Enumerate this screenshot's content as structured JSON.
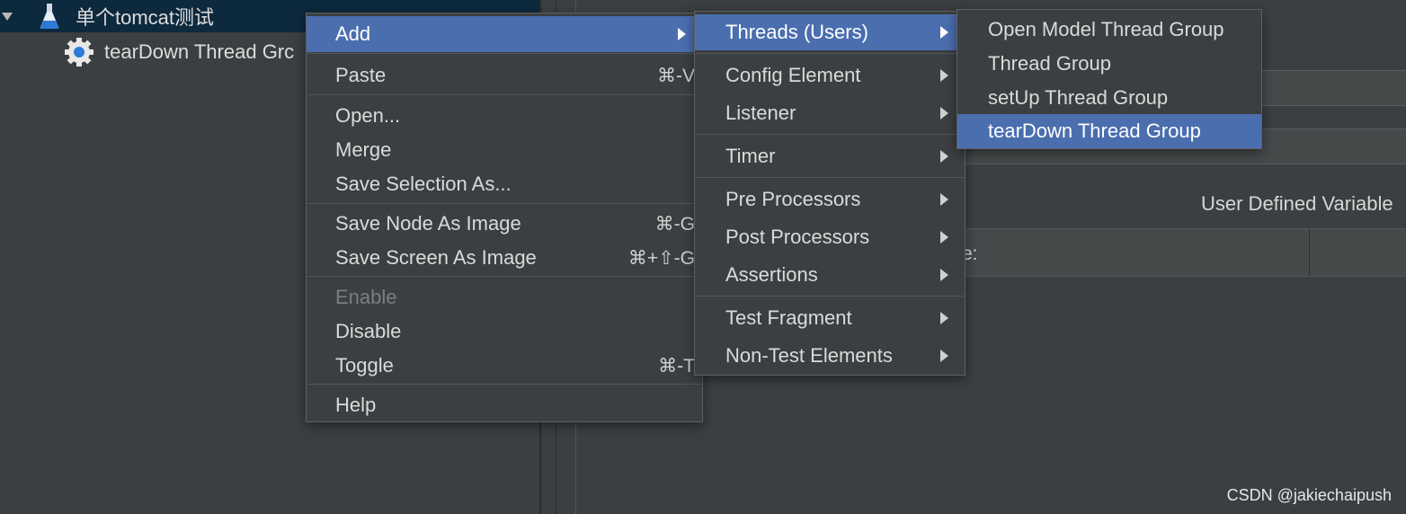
{
  "tree": {
    "root_label": "单个tomcat测试",
    "child_label": "tearDown Thread Grc"
  },
  "right_pane": {
    "udv_label": "User Defined Variable",
    "table_col_text": "e:"
  },
  "context_menu": {
    "items": [
      {
        "label": "Add",
        "shortcut": "",
        "submenu": true
      },
      {
        "label": "Paste",
        "shortcut": "⌘-V"
      },
      {
        "label": "Open...",
        "shortcut": ""
      },
      {
        "label": "Merge",
        "shortcut": ""
      },
      {
        "label": "Save Selection As...",
        "shortcut": ""
      },
      {
        "label": "Save Node As Image",
        "shortcut": "⌘-G"
      },
      {
        "label": "Save Screen As Image",
        "shortcut": "⌘+⇧-G"
      },
      {
        "label": "Enable",
        "shortcut": "",
        "disabled": true
      },
      {
        "label": "Disable",
        "shortcut": ""
      },
      {
        "label": "Toggle",
        "shortcut": "⌘-T"
      },
      {
        "label": "Help",
        "shortcut": ""
      }
    ]
  },
  "add_menu": {
    "items": [
      {
        "label": "Threads (Users)"
      },
      {
        "label": "Config Element"
      },
      {
        "label": "Listener"
      },
      {
        "label": "Timer"
      },
      {
        "label": "Pre Processors"
      },
      {
        "label": "Post Processors"
      },
      {
        "label": "Assertions"
      },
      {
        "label": "Test Fragment"
      },
      {
        "label": "Non-Test Elements"
      }
    ]
  },
  "threads_menu": {
    "items": [
      {
        "label": "Open Model Thread Group"
      },
      {
        "label": "Thread Group"
      },
      {
        "label": "setUp Thread Group"
      },
      {
        "label": "tearDown Thread Group"
      }
    ]
  },
  "colors": {
    "background": "#3c3f41",
    "highlight": "#4b6eaf",
    "selected_row": "#0d293e",
    "text": "#dadada",
    "disabled_text": "#7b7d7f"
  },
  "icons": {
    "root": "flask-icon",
    "child": "gear-icon",
    "submenu": "triangle-right-icon",
    "expand": "triangle-down-icon"
  },
  "watermark": "CSDN @jakiechaipush"
}
